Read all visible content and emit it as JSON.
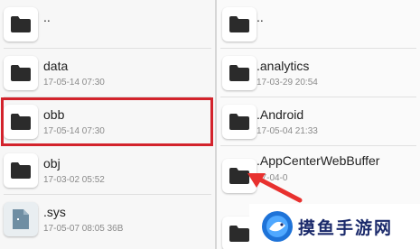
{
  "left_pane": {
    "items": [
      {
        "name": "..",
        "meta": "",
        "type": "folder"
      },
      {
        "name": "data",
        "meta": "17-05-14 07:30",
        "type": "folder"
      },
      {
        "name": "obb",
        "meta": "17-05-14 07:30",
        "type": "folder",
        "selected": true
      },
      {
        "name": "obj",
        "meta": "17-03-02 05:52",
        "type": "folder"
      },
      {
        "name": ".sys",
        "meta": "17-05-07 08:05  36B",
        "type": "file"
      }
    ]
  },
  "right_pane": {
    "items": [
      {
        "name": "..",
        "meta": "",
        "type": "folder"
      },
      {
        "name": ".analytics",
        "meta": "17-03-29 20:54",
        "type": "folder"
      },
      {
        "name": ".Android",
        "meta": "17-05-04 21:33",
        "type": "folder"
      },
      {
        "name": ".AppCenterWebBuffer",
        "meta": "17-04-0",
        "type": "folder"
      }
    ]
  },
  "colors": {
    "highlight": "#d3232c",
    "arrow": "#e8312f",
    "folder_icon": "#2b2b2b",
    "file_icon": "#6f8ea3"
  },
  "watermark": {
    "text": "摸鱼手游网"
  }
}
